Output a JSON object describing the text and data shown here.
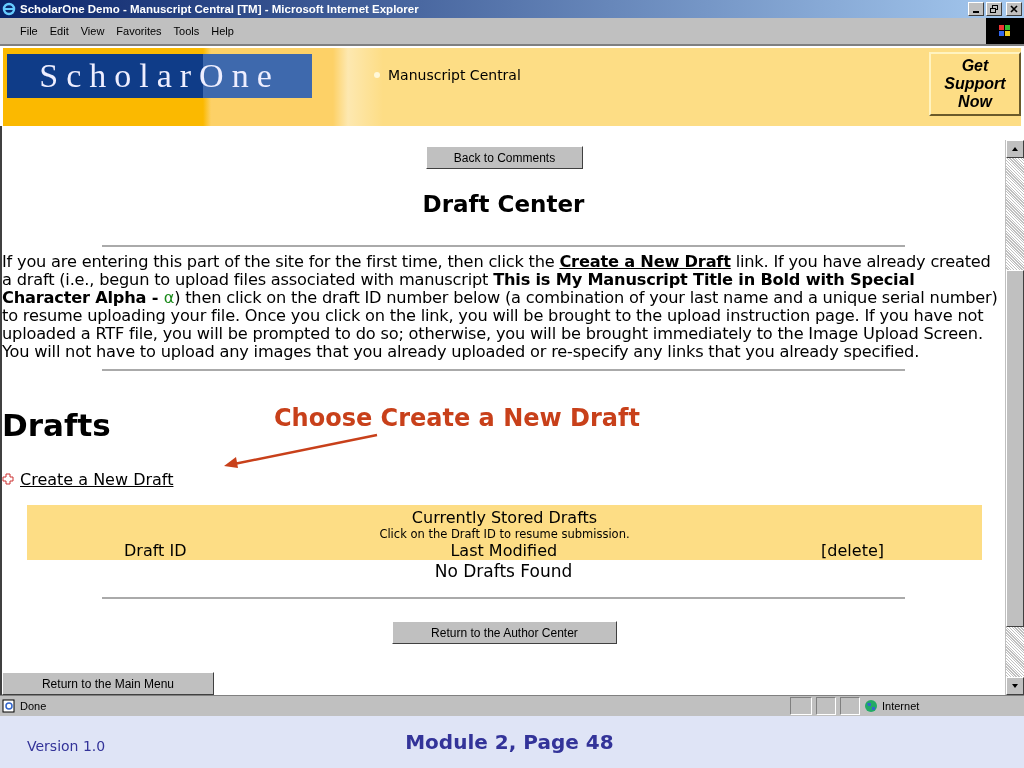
{
  "window": {
    "title": "ScholarOne Demo - Manuscript Central [TM] - Microsoft Internet Explorer"
  },
  "menu": [
    "File",
    "Edit",
    "View",
    "Favorites",
    "Tools",
    "Help"
  ],
  "header": {
    "logo": "ScholarOne",
    "site": "Manuscript Central",
    "support": [
      "Get",
      "Support",
      "Now"
    ]
  },
  "back_button": "Back to Comments",
  "page_title": "Draft Center",
  "intro": [
    {
      "kind": "text",
      "text": "If you are entering this part of the site for the first time, then click the "
    },
    {
      "kind": "link",
      "text": "Create a New Draft"
    },
    {
      "kind": "text",
      "text": " link. If you have already created a draft (i.e., begun to upload files associated with manuscript "
    },
    {
      "kind": "bold",
      "text": "This is My Manuscript Title in Bold with Special Character Alpha - "
    },
    {
      "kind": "symbol",
      "text": "α"
    },
    {
      "kind": "text",
      "text": ") then click on the draft ID number below (a combination of your last name and a unique serial number) to resume uploading your file. Once you click on the link, you will be brought to the upload instruction page. If you have not uploaded a RTF file, you will be prompted to do so; otherwise, you will be brought immediately to the Image Upload Screen. You will not have to upload any images that you already uploaded or re-specify any links that you already specified."
    }
  ],
  "drafts_heading": "Drafts",
  "annotation": "Choose Create a New Draft",
  "create_link": "Create a New Draft",
  "table": {
    "title": "Currently Stored Drafts",
    "hint": "Click on the Draft ID to resume submission.",
    "columns": [
      "Draft ID",
      "Last Modified",
      "[delete]"
    ],
    "empty": "No Drafts Found"
  },
  "author_button": "Return to the Author Center",
  "main_menu_button": "Return to the Main Menu",
  "status_bar": {
    "status": "Done",
    "zone": "Internet"
  },
  "footer": {
    "version": "Version 1.0",
    "page": "Module 2, Page 48"
  }
}
